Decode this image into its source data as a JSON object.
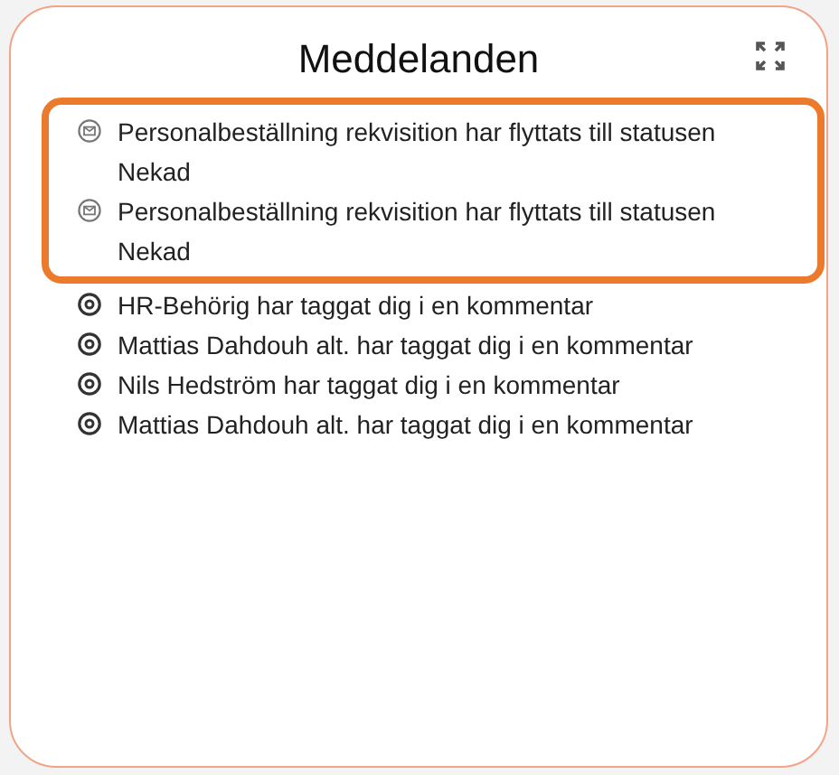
{
  "card": {
    "title": "Meddelanden"
  },
  "notifications": [
    {
      "kind": "status",
      "text": "Personalbeställning rekvisition har flyttats till statusen Nekad",
      "highlighted": true
    },
    {
      "kind": "status",
      "text": "Personalbeställning rekvisition har flyttats till statusen Nekad",
      "highlighted": true
    },
    {
      "kind": "mention",
      "text": "HR-Behörig har taggat dig i en kommentar",
      "highlighted": false
    },
    {
      "kind": "mention",
      "text": "Mattias Dahdouh alt. har taggat dig i en kommentar",
      "highlighted": false
    },
    {
      "kind": "mention",
      "text": "Nils Hedström har taggat dig i en kommentar",
      "highlighted": false
    },
    {
      "kind": "mention",
      "text": "Mattias Dahdouh alt. har taggat dig i en kommentar",
      "highlighted": false
    }
  ]
}
